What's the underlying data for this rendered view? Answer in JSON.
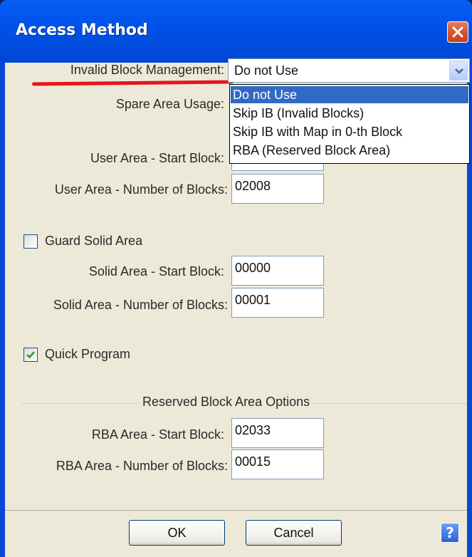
{
  "window": {
    "title": "Access Method"
  },
  "invalid_block": {
    "label": "Invalid Block Management:",
    "selected": "Do not Use",
    "options": [
      "Do not Use",
      "Skip IB (Invalid Blocks)",
      "Skip IB with Map in 0-th Block",
      "RBA (Reserved Block Area)"
    ]
  },
  "spare_area": {
    "label": "Spare Area Usage:"
  },
  "user_area": {
    "start_label": "User Area - Start Block:",
    "start_value": "",
    "number_label": "User Area - Number of Blocks:",
    "number_value": "02008"
  },
  "guard_solid": {
    "label": "Guard Solid Area",
    "checked": false
  },
  "solid_area": {
    "start_label": "Solid Area - Start Block:",
    "start_value": "00000",
    "number_label": "Solid Area - Number of Blocks:",
    "number_value": "00001"
  },
  "quick_program": {
    "label": "Quick Program",
    "checked": true
  },
  "rba_group": {
    "title": "Reserved Block Area Options"
  },
  "rba_area": {
    "start_label": "RBA Area - Start Block:",
    "start_value": "02033",
    "number_label": "RBA Area - Number of Blocks:",
    "number_value": "00015"
  },
  "buttons": {
    "ok": "OK",
    "cancel": "Cancel",
    "help": "?"
  },
  "colors": {
    "accent": "#316ac5",
    "annotation": "#e8141b",
    "titlebar": "#0053e9"
  }
}
